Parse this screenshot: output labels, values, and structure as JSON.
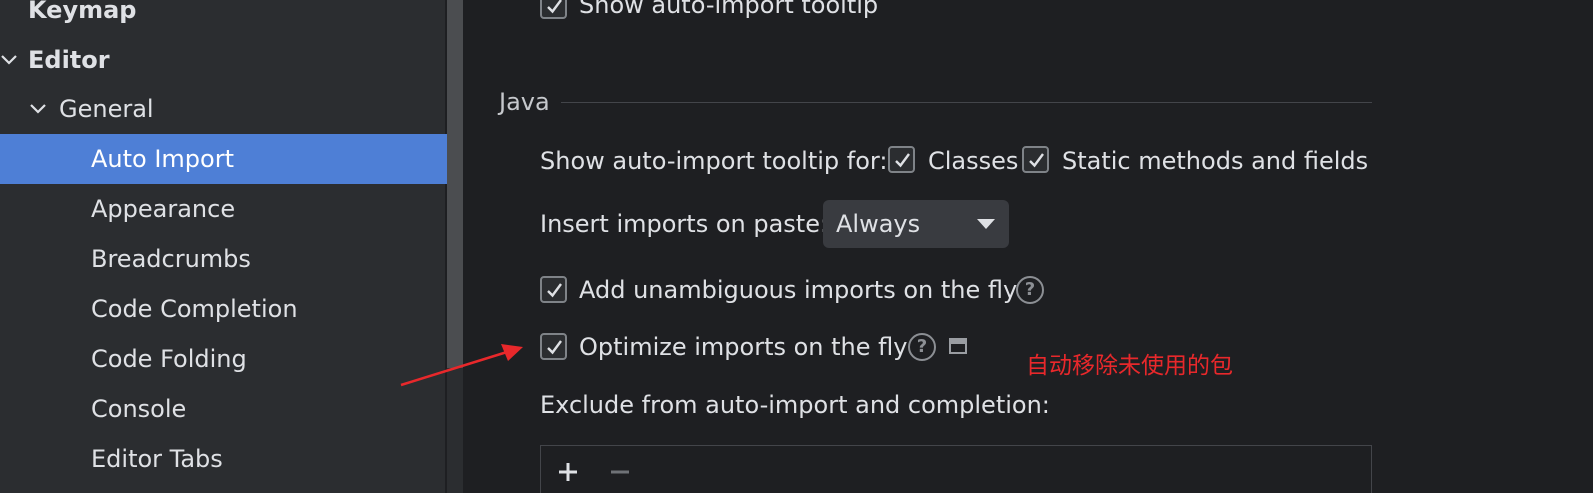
{
  "sidebar": {
    "items": [
      {
        "label": "Keymap",
        "level": 0,
        "bold": true,
        "expanded": false,
        "selected": false
      },
      {
        "label": "Editor",
        "level": 0,
        "bold": true,
        "expanded": true,
        "selected": false
      },
      {
        "label": "General",
        "level": 1,
        "bold": false,
        "expanded": true,
        "selected": false
      },
      {
        "label": "Auto Import",
        "level": 2,
        "bold": false,
        "selected": true
      },
      {
        "label": "Appearance",
        "level": 2,
        "bold": false,
        "selected": false
      },
      {
        "label": "Breadcrumbs",
        "level": 2,
        "bold": false,
        "selected": false
      },
      {
        "label": "Code Completion",
        "level": 2,
        "bold": false,
        "selected": false
      },
      {
        "label": "Code Folding",
        "level": 2,
        "bold": false,
        "selected": false
      },
      {
        "label": "Console",
        "level": 2,
        "bold": false,
        "selected": false
      },
      {
        "label": "Editor Tabs",
        "level": 2,
        "bold": false,
        "selected": false
      }
    ]
  },
  "main": {
    "top_option": {
      "label": "Show auto-import tooltip",
      "checked": true
    },
    "java_group": {
      "title": "Java",
      "tooltip_for_label": "Show auto-import tooltip for:",
      "classes": {
        "label": "Classes",
        "checked": true
      },
      "static_methods": {
        "label": "Static methods and fields",
        "checked": true
      },
      "insert_on_paste_label": "Insert imports on paste:",
      "insert_on_paste_value": "Always",
      "add_unambiguous": {
        "label": "Add unambiguous imports on the fly",
        "checked": true,
        "help_icon": "question-circle-icon"
      },
      "optimize_imports": {
        "label": "Optimize imports on the fly",
        "checked": true,
        "help_icon": "question-circle-icon",
        "extra_icon": "window-icon"
      },
      "exclude_label": "Exclude from auto-import and completion:",
      "exclude_toolbar": {
        "add_icon": "plus-icon",
        "remove_icon": "minus-icon"
      }
    }
  },
  "annotation": {
    "text": "自动移除未使用的包",
    "color": "#e8282b"
  },
  "colors": {
    "selection": "#4e7fd6",
    "background": "#1e1f22",
    "sidebar": "#2b2d30",
    "annotation": "#e8282b"
  }
}
